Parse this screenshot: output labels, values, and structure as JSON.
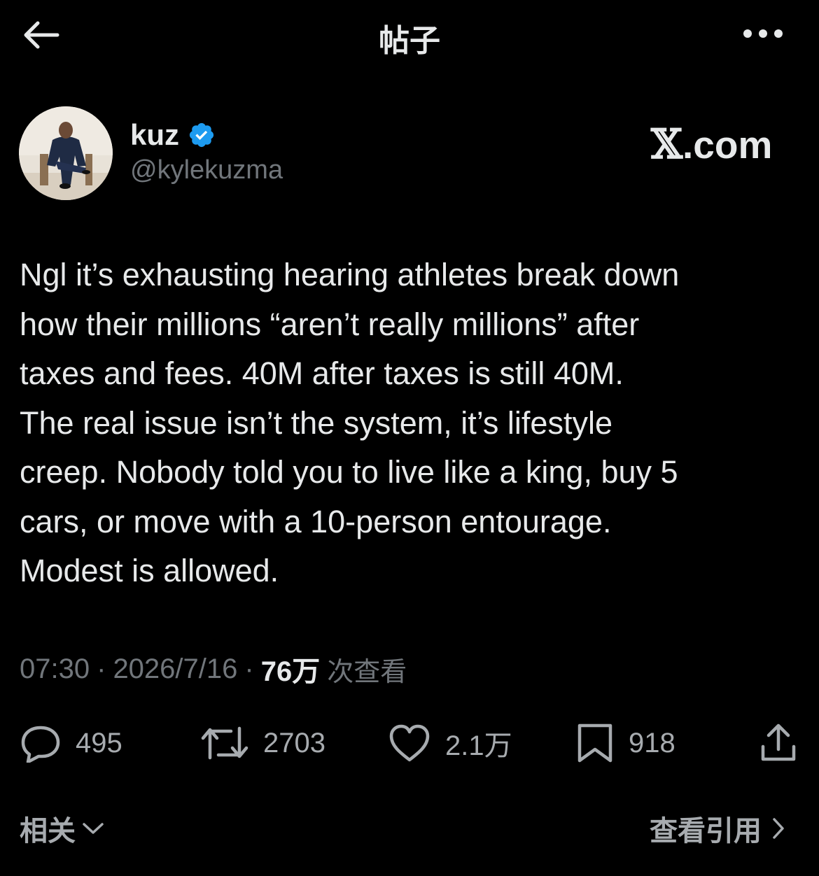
{
  "header": {
    "title": "帖子",
    "back_icon": "arrow-left-icon",
    "more_icon": "more-horizontal-icon"
  },
  "author": {
    "display_name": "kuz",
    "handle": "@kylekuzma",
    "verified": true,
    "verified_color": "#1d9bf0"
  },
  "watermark": {
    "x": "𝕏",
    "rest": ".com"
  },
  "tweet": {
    "text": "Ngl it’s exhausting hearing athletes break down\nhow their millions “aren’t really millions” after\ntaxes and fees. 40M after taxes is still 40M.\nThe real issue isn’t the system, it’s lifestyle\ncreep. Nobody told you to live like a king, buy 5\ncars, or move with a 10-person entourage.\nModest is allowed."
  },
  "meta": {
    "time": "07:30",
    "separator": "·",
    "date": "2026/7/16",
    "views_count": "76万",
    "views_label": "次查看"
  },
  "actions": {
    "replies": "495",
    "reposts": "2703",
    "likes": "2.1万",
    "bookmarks": "918"
  },
  "footer": {
    "related_label": "相关",
    "view_quotes_label": "查看引用"
  },
  "colors": {
    "background": "#000000",
    "primary_text": "#e7e9ea",
    "secondary_text": "#71767b",
    "icon": "#a7abaf"
  }
}
